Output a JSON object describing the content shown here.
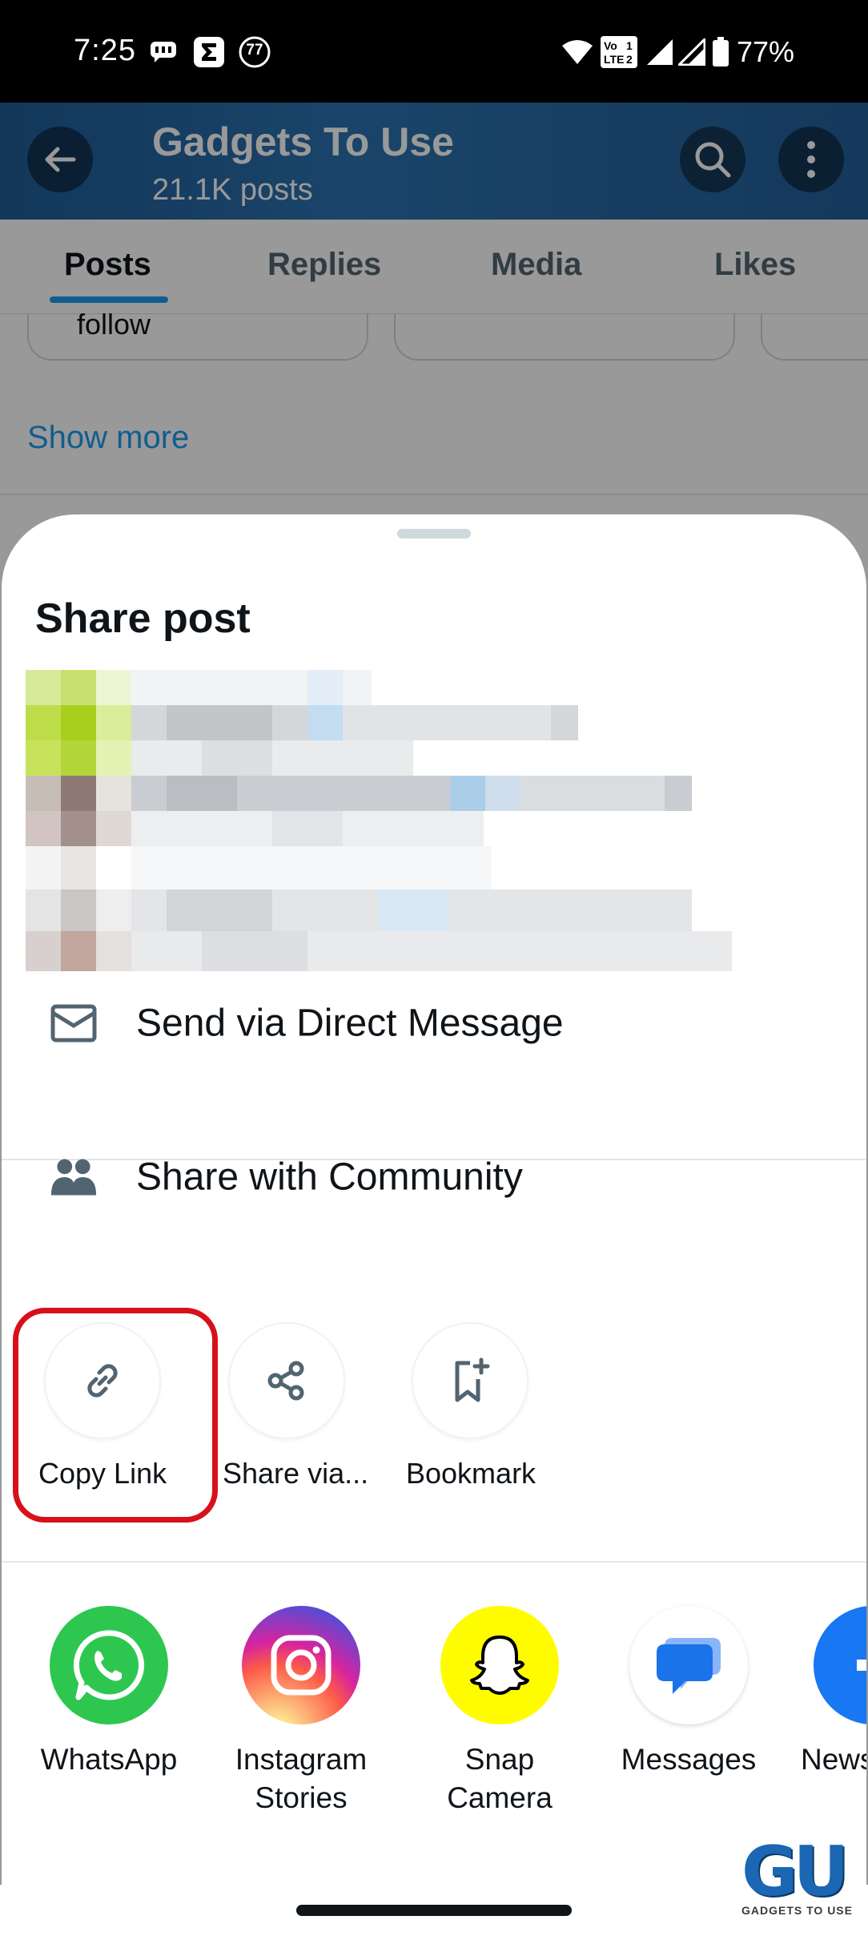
{
  "status_bar": {
    "time": "7:25",
    "notif_badge": "77",
    "battery_percent": "77%",
    "volte_top": "Vo",
    "volte_bottom": "LTE",
    "sim_1": "1",
    "sim_2": "2"
  },
  "background": {
    "header_title": "Gadgets To Use",
    "header_subtitle": "21.1K posts",
    "tabs": [
      "Posts",
      "Replies",
      "Media",
      "Likes"
    ],
    "follow_text": "follow",
    "show_more": "Show more"
  },
  "sheet": {
    "title": "Share post",
    "rows": {
      "direct_message": "Send via Direct Message",
      "community": "Share with Community"
    },
    "actions": [
      {
        "label": "Copy Link",
        "icon": "link-icon"
      },
      {
        "label": "Share via...",
        "icon": "share-nodes-icon"
      },
      {
        "label": "Bookmark",
        "icon": "bookmark-plus-icon"
      }
    ],
    "apps": [
      {
        "line1": "WhatsApp",
        "line2": "",
        "icon": "whatsapp-icon"
      },
      {
        "line1": "Instagram",
        "line2": "Stories",
        "icon": "instagram-icon"
      },
      {
        "line1": "Snap",
        "line2": "Camera",
        "icon": "snapchat-icon"
      },
      {
        "line1": "Messages",
        "line2": "",
        "icon": "messages-icon"
      },
      {
        "line1": "News",
        "line2": "",
        "icon": "facebook-icon"
      }
    ]
  },
  "watermark": {
    "logo": "GU",
    "text": "GADGETS TO USE"
  },
  "colors": {
    "accent": "#1d9bf0",
    "highlight": "#d8101a",
    "header_bg": "#2c72b0",
    "whatsapp": "#29c44c",
    "snapchat": "#fffc00",
    "messages": "#1a73e8",
    "facebook": "#1877f2"
  }
}
